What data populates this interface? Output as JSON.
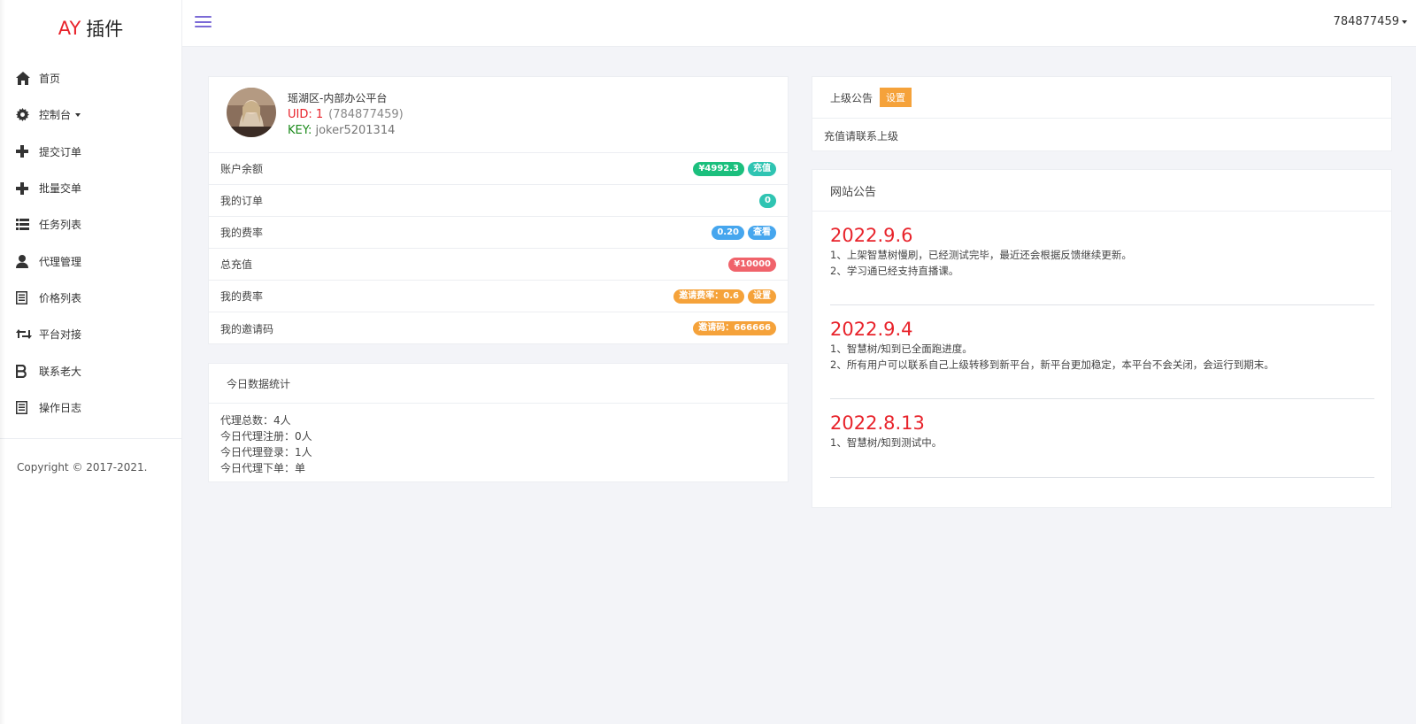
{
  "sidebar": {
    "logo_accent": "AY",
    "logo_text": "插件",
    "items": [
      {
        "label": "首页",
        "icon": "home-icon"
      },
      {
        "label": "控制台",
        "icon": "gear-icon",
        "dropdown": true
      },
      {
        "label": "提交订单",
        "icon": "plus-icon"
      },
      {
        "label": "批量交单",
        "icon": "plus-icon"
      },
      {
        "label": "任务列表",
        "icon": "list-icon"
      },
      {
        "label": "代理管理",
        "icon": "user-icon"
      },
      {
        "label": "价格列表",
        "icon": "document-icon"
      },
      {
        "label": "平台对接",
        "icon": "retweet-icon"
      },
      {
        "label": "联系老大",
        "icon": "bitcoin-icon"
      },
      {
        "label": "操作日志",
        "icon": "document-icon"
      }
    ],
    "copyright": "Copyright © 2017-2021."
  },
  "topbar": {
    "user": "784877459"
  },
  "profile": {
    "name": "瑶湖区-内部办公平台",
    "uid_label": "UID: 1",
    "uid_account": "(784877459)",
    "key_label": "KEY:",
    "key_value": "joker5201314",
    "stats": [
      {
        "label": "账户余额",
        "badges": [
          {
            "text": "¥4992.3",
            "color": "#1bbf7d"
          },
          {
            "text": "充值",
            "color": "#2fc4b2"
          }
        ]
      },
      {
        "label": "我的订单",
        "badges": [
          {
            "text": "0",
            "color": "#2fc4b2"
          }
        ]
      },
      {
        "label": "我的费率",
        "badges": [
          {
            "text": "0.20",
            "color": "#46a6ee"
          },
          {
            "text": "查看",
            "color": "#46a6ee"
          }
        ]
      },
      {
        "label": "总充值",
        "badges": [
          {
            "text": "¥10000",
            "color": "#f0636b"
          }
        ]
      },
      {
        "label": "我的费率",
        "badges": [
          {
            "text": "邀请费率：0.6",
            "color": "#f5a23a"
          },
          {
            "text": "设置",
            "color": "#f5a23a"
          }
        ]
      },
      {
        "label": "我的邀请码",
        "badges": [
          {
            "text": "邀请码：666666",
            "color": "#f5a23a"
          }
        ]
      }
    ]
  },
  "today": {
    "title": "今日数据统计",
    "lines": [
      "代理总数：4人",
      "今日代理注册：0人",
      "今日代理登录：1人",
      "今日代理下单：单"
    ]
  },
  "notice": {
    "title": "上级公告",
    "button": "设置",
    "body": "充值请联系上级"
  },
  "site": {
    "title": "网站公告",
    "items": [
      {
        "date": "2022.9.6",
        "lines": [
          "1、上架智慧树慢刷，已经测试完毕，最近还会根据反馈继续更新。",
          "2、学习通已经支持直播课。"
        ]
      },
      {
        "date": "2022.9.4",
        "lines": [
          "1、智慧树/知到已全面跑进度。",
          "2、所有用户可以联系自己上级转移到新平台，新平台更加稳定，本平台不会关闭，会运行到期末。"
        ]
      },
      {
        "date": "2022.8.13",
        "lines": [
          "1、智慧树/知到测试中。"
        ]
      }
    ]
  }
}
